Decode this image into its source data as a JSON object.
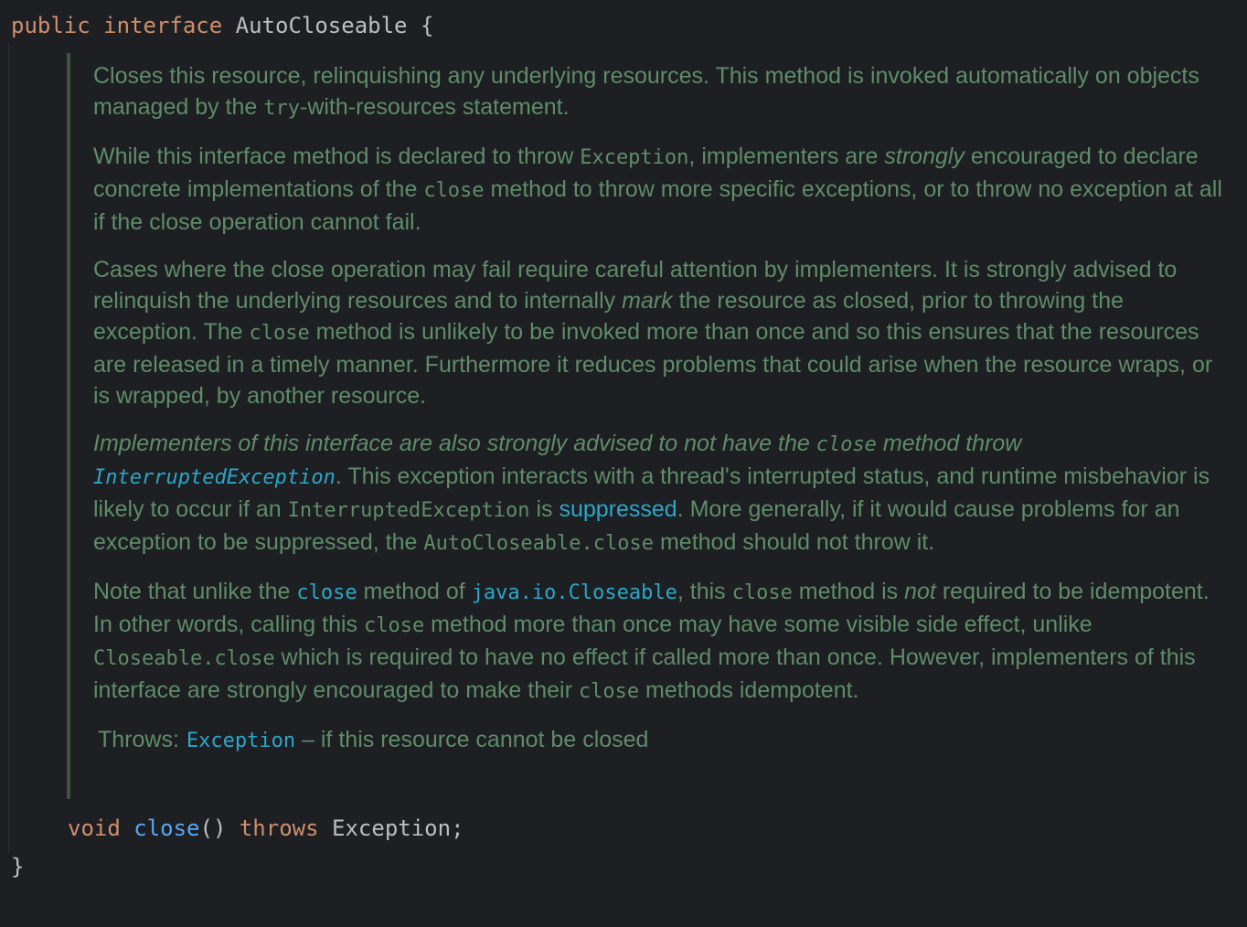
{
  "code": {
    "line1": {
      "kw_public": "public",
      "kw_interface": "interface",
      "type_name": "AutoCloseable",
      "brace_open": "{"
    },
    "method": {
      "kw_void": "void",
      "name": "close",
      "parens": "()",
      "kw_throws": "throws",
      "exception": "Exception",
      "semicolon": ";"
    },
    "brace_close": "}"
  },
  "doc": {
    "p1": {
      "t1": "Closes this resource, relinquishing any underlying resources. This method is invoked automatically on objects managed by the ",
      "c1": "try",
      "t2": "-with-resources statement."
    },
    "p2": {
      "t1": "While this interface method is declared to throw ",
      "c1": "Exception",
      "t2": ", implementers are ",
      "em1": "strongly",
      "t3": " encouraged to declare concrete implementations of the ",
      "c2": "close",
      "t4": " method to throw more specific exceptions, or to throw no exception at all if the close operation cannot fail."
    },
    "p3": {
      "t1": "Cases where the close operation may fail require careful attention by implementers. It is strongly advised to relinquish the underlying resources and to internally ",
      "em1": "mark",
      "t2": " the resource as closed, prior to throwing the exception. The ",
      "c1": "close",
      "t3": " method is unlikely to be invoked more than once and so this ensures that the resources are released in a timely manner. Furthermore it reduces problems that could arise when the resource wraps, or is wrapped, by another resource."
    },
    "p4": {
      "t1": "Implementers of this interface are also strongly advised to not have the ",
      "c1": "close",
      "t2": " method throw ",
      "link1": "InterruptedException",
      "t3": ". This exception interacts with a thread's interrupted status, and runtime misbehavior is likely to occur if an ",
      "c2": "InterruptedException",
      "t4": " is ",
      "link2": "suppressed",
      "t5": ". More generally, if it would cause problems for an exception to be suppressed, the ",
      "c3": "AutoCloseable.close",
      "t6": " method should not throw it."
    },
    "p5": {
      "t1": "Note that unlike the ",
      "link1": "close",
      "t2": " method of ",
      "link2": "java.io.Closeable",
      "t3": ", this ",
      "c1": "close",
      "t4": " method is ",
      "em1": "not",
      "t5": " required to be idempotent. In other words, calling this ",
      "c2": "close",
      "t6": " method more than once may have some visible side effect, unlike ",
      "c3": "Closeable.close",
      "t7": " which is required to have no effect if called more than once. However, implementers of this interface are strongly encouraged to make their ",
      "c4": "close",
      "t8": " methods idempotent."
    },
    "throws": {
      "label": "Throws:",
      "link": "Exception",
      "desc": " – if this resource cannot be closed"
    }
  },
  "colors": {
    "background": "#1e1f22",
    "keyword": "#cf8e6d",
    "method_name": "#56a8f5",
    "doc_text": "#5f8c6a",
    "doc_link": "#2aa7c9",
    "doc_border": "#3e5342"
  }
}
